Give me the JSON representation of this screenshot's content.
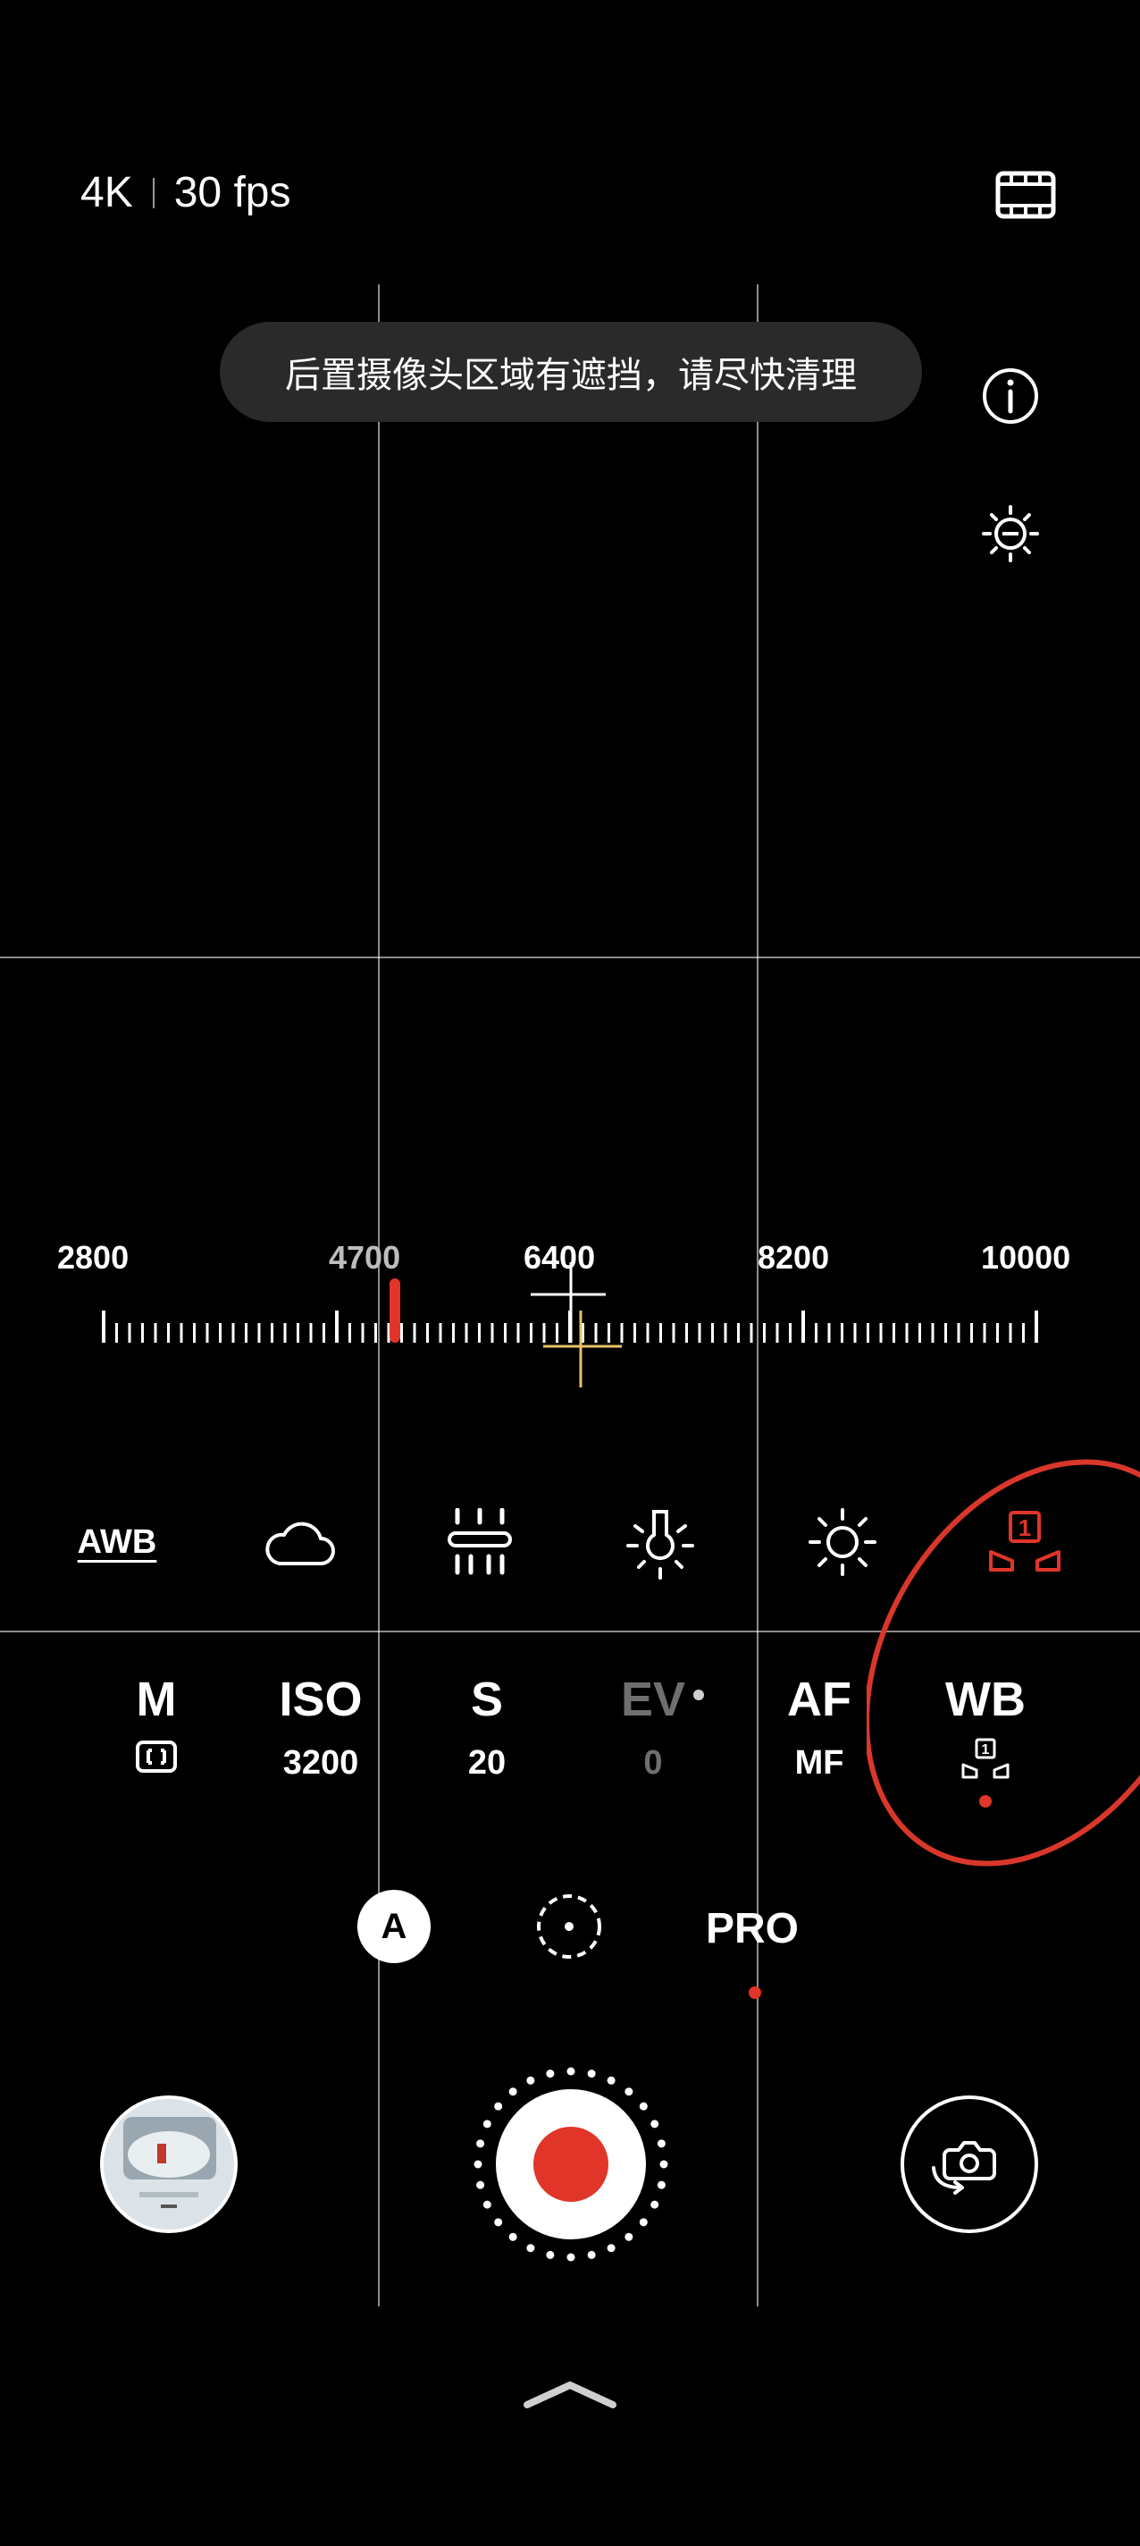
{
  "header": {
    "resolution": "4K",
    "frame_rate": "30 fps",
    "icons": [
      "video-format-icon"
    ]
  },
  "toast": {
    "message": "后置摄像头区域有遮挡，请尽快清理"
  },
  "side_icons": [
    "info-icon",
    "exposure-meter-icon"
  ],
  "wb_scale": {
    "labels": [
      "2800",
      "4700",
      "6400",
      "8200",
      "10000"
    ],
    "current_value": 4700,
    "range": [
      2800,
      10000
    ]
  },
  "wb_presets": {
    "items": [
      {
        "label": "AWB",
        "icon": "awb-icon"
      },
      {
        "label": "",
        "icon": "cloudy-icon"
      },
      {
        "label": "",
        "icon": "fluorescent-icon"
      },
      {
        "label": "",
        "icon": "incandescent-icon"
      },
      {
        "label": "",
        "icon": "daylight-icon"
      },
      {
        "label": "1",
        "icon": "custom-wb-icon"
      }
    ],
    "selected_index": 5
  },
  "params": [
    {
      "name": "M",
      "value": "",
      "icon": "metering-icon"
    },
    {
      "name": "ISO",
      "value": "3200"
    },
    {
      "name": "S",
      "value": "20"
    },
    {
      "name": "EV",
      "value": "0",
      "disabled": true
    },
    {
      "name": "AF",
      "value": "MF"
    },
    {
      "name": "WB",
      "value": "1",
      "icon": "custom-wb-icon",
      "active": true
    }
  ],
  "modes": {
    "auto_label": "A",
    "pro_label": "PRO"
  },
  "colors": {
    "accent_red": "#e03528",
    "focus_yellow": "#e8c26a",
    "toast_bg": "#2a2a2a"
  }
}
